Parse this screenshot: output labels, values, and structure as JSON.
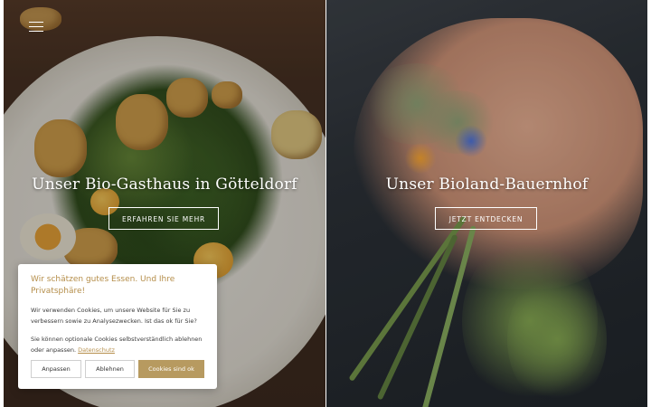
{
  "nav": {
    "menu_icon": "hamburger-menu-icon"
  },
  "hero_left": {
    "title": "Unser Bio-Gasthaus in Götteldorf",
    "button_label": "ERFAHREN SIE MEHR"
  },
  "hero_right": {
    "title": "Unser Bioland-Bauernhof",
    "button_label": "JETZT ENTDECKEN"
  },
  "cookie_banner": {
    "title_line1": "Wir schätzen gutes Essen. Und Ihre",
    "title_line2": "Privatsphäre!",
    "text_line1": "Wir verwenden Cookies, um unsere Website für Sie zu",
    "text_line2": "verbessern sowie zu Analysezwecken. Ist das ok für Sie?",
    "text_line3": "Sie können optionale Cookies selbstverständlich ablehnen",
    "text_line4_prefix": "oder anpassen.",
    "privacy_link": "Datenschutz",
    "btn_customize": "Anpassen",
    "btn_reject": "Ablehnen",
    "btn_accept": "Cookies sind ok"
  },
  "colors": {
    "accent": "#b58e4a",
    "accept_button": "#b79a60"
  }
}
